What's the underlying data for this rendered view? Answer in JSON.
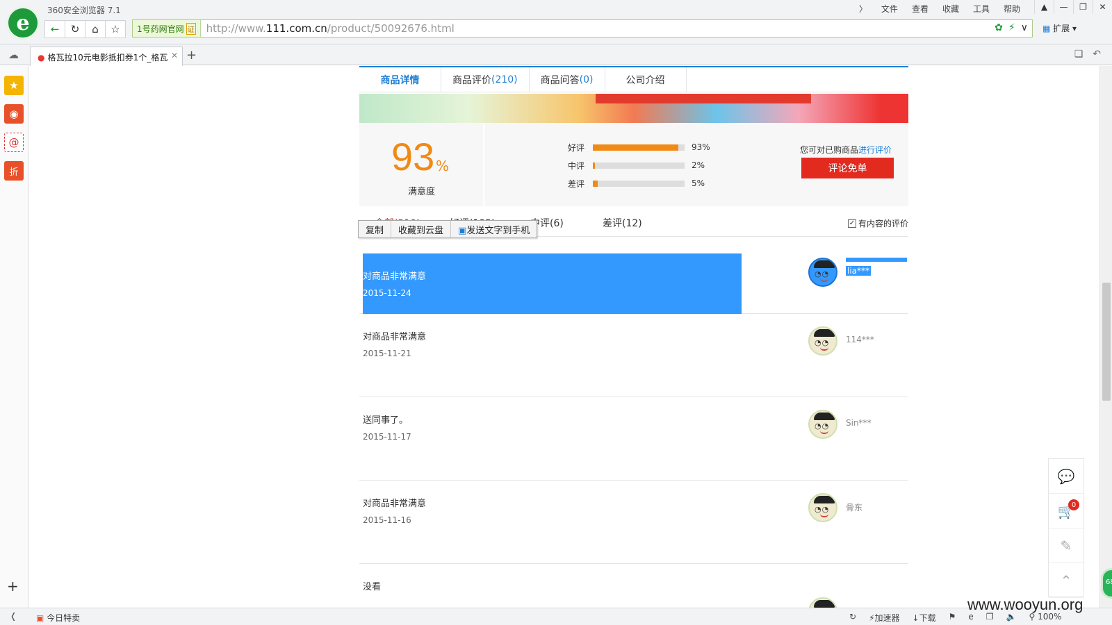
{
  "browser": {
    "app_title": "360安全浏览器 7.1",
    "menu": [
      "文件",
      "查看",
      "收藏",
      "工具",
      "帮助"
    ],
    "menu_arrow": "〉",
    "site_badge": "1号药网官网",
    "cert_label": "证",
    "url_prefix": "http://www.",
    "url_domain": "111.com.cn",
    "url_path": "/product/50092676.html",
    "extensions_label": "扩展",
    "tab_title": "格瓦拉10元电影抵扣券1个_格瓦",
    "logo_letter": "e"
  },
  "product_tabs": [
    {
      "label": "商品详情",
      "count": ""
    },
    {
      "label": "商品评价",
      "count": "(210)"
    },
    {
      "label": "商品问答",
      "count": "(0)"
    },
    {
      "label": "公司介绍",
      "count": ""
    }
  ],
  "satisfaction": {
    "value": "93",
    "unit": "%",
    "label": "满意度",
    "rows": [
      {
        "label": "好评",
        "pct_text": "93%",
        "pct": 93
      },
      {
        "label": "中评",
        "pct_text": "2%",
        "pct": 2
      },
      {
        "label": "差评",
        "pct_text": "5%",
        "pct": 5
      }
    ],
    "hint_prefix": "您可对已购商品",
    "hint_link": "进行评价",
    "button": "评论免单"
  },
  "filters": {
    "all": "全部(210)",
    "good": "好评(192)",
    "mid": "中评(6)",
    "bad": "差评(12)",
    "has_content": "有内容的评价",
    "checkbox_mark": "✓"
  },
  "context_menu": [
    "复制",
    "收藏到云盘",
    "发送文字到手机"
  ],
  "reviews": [
    {
      "text": "对商品非常满意",
      "date": "2015-11-24",
      "user": "lia***",
      "selected": true
    },
    {
      "text": "对商品非常满意",
      "date": "2015-11-21",
      "user": "114***",
      "selected": false
    },
    {
      "text": "送同事了。",
      "date": "2015-11-17",
      "user": "Sin***",
      "selected": false
    },
    {
      "text": "对商品非常满意",
      "date": "2015-11-16",
      "user": "骨东",
      "selected": false
    },
    {
      "text": "没看",
      "date": "",
      "user": "",
      "selected": false
    }
  ],
  "float_panel": {
    "cart_count": "0"
  },
  "status_bar": {
    "today_sale": "今日特卖",
    "accelerator": "加速器",
    "download": "下载",
    "zoom": "100%"
  },
  "watermark": "www.wooyun.org",
  "green_widget": "68"
}
